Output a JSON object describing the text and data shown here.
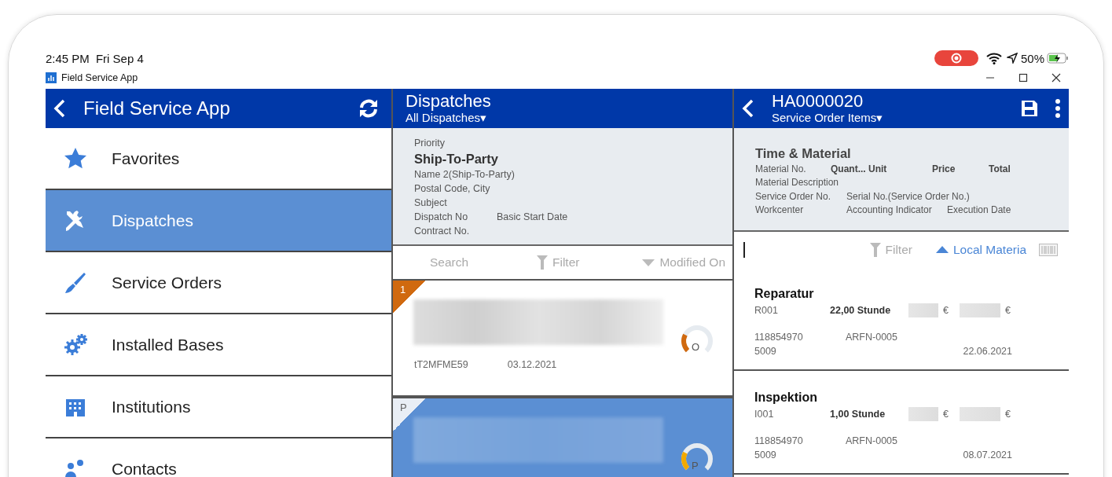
{
  "status_bar": {
    "time": "2:45 PM",
    "date": "Fri Sep 4",
    "battery": "50%"
  },
  "window": {
    "title": "Field Service App"
  },
  "sidebar": {
    "title": "Field Service App",
    "items": [
      {
        "label": "Favorites",
        "kind": "star",
        "selected": false
      },
      {
        "label": "Dispatches",
        "kind": "tools",
        "selected": true
      },
      {
        "label": "Service Orders",
        "kind": "brush",
        "selected": false
      },
      {
        "label": "Installed Bases",
        "kind": "gears",
        "selected": false
      },
      {
        "label": "Institutions",
        "kind": "building",
        "selected": false
      },
      {
        "label": "Contacts",
        "kind": "people",
        "selected": false
      }
    ]
  },
  "dispatches": {
    "title": "Dispatches",
    "view": "All Dispatches▾",
    "legend": [
      {
        "kind": "label",
        "cells": [
          "Priority"
        ]
      },
      {
        "kind": "heading",
        "cells": [
          "Ship-To-Party"
        ]
      },
      {
        "kind": "label",
        "cells": [
          "Name 2(Ship-To-Party)"
        ]
      },
      {
        "kind": "label",
        "cells": [
          "Postal Code, City"
        ]
      },
      {
        "kind": "label",
        "cells": [
          "Subject"
        ]
      },
      {
        "kind": "label",
        "cells": [
          "Dispatch No",
          "Basic Start Date"
        ]
      },
      {
        "kind": "label",
        "cells": [
          "Contract No."
        ]
      }
    ],
    "toolbar": {
      "search_placeholder": "Search",
      "filter": "Filter",
      "sort": "Modified On"
    },
    "cards": [
      {
        "priority": "1",
        "number": "tT2MFME59",
        "date": "03.12.2021",
        "status": "O",
        "color": "#d0690f",
        "selected": false
      },
      {
        "priority": "P",
        "status": "P",
        "color": "#f2a900",
        "selected": true
      }
    ]
  },
  "order": {
    "title": "HA0000020",
    "view": "Service Order Items▾",
    "legend_title": "Time & Material",
    "legend": [
      [
        "Material No.",
        "Quant... Unit",
        "Price",
        "Total"
      ],
      [
        "Material Description"
      ],
      [
        "Service Order No.",
        "Serial No.(Service Order No.)"
      ],
      [
        "Workcenter",
        "Accounting Indicator",
        "Execution Date"
      ]
    ],
    "toolbar": {
      "filter": "Filter",
      "sort": "Local Materia"
    },
    "items": [
      {
        "name": "Reparatur",
        "code": "R001",
        "quantity": "22,00 Stunde",
        "price_currency": "€",
        "total_currency": "€",
        "service_order": "118854970",
        "serial": "ARFN-0005",
        "workcenter": "5009",
        "date": "22.06.2021"
      },
      {
        "name": "Inspektion",
        "code": "I001",
        "quantity": "1,00 Stunde",
        "price_currency": "€",
        "total_currency": "€",
        "service_order": "118854970",
        "serial": "ARFN-0005",
        "workcenter": "5009",
        "date": "08.07.2021"
      }
    ]
  }
}
